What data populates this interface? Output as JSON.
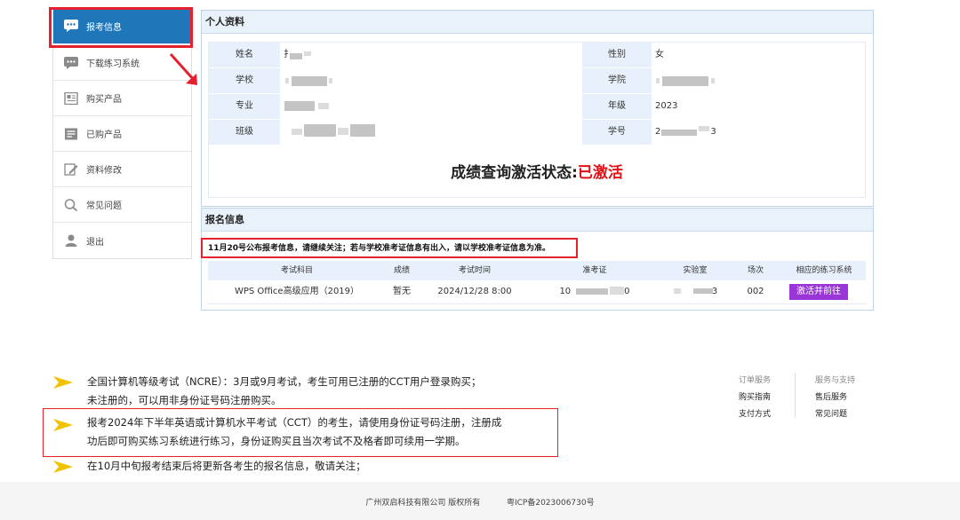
{
  "sidebar": {
    "items": [
      {
        "label": "报考信息",
        "icon": "chat-icon",
        "active": true
      },
      {
        "label": "下载练习系统",
        "icon": "chat-icon"
      },
      {
        "label": "购买产品",
        "icon": "newspaper-icon"
      },
      {
        "label": "已购产品",
        "icon": "list-icon"
      },
      {
        "label": "资料修改",
        "icon": "edit-icon"
      },
      {
        "label": "常见问题",
        "icon": "search-icon"
      },
      {
        "label": "退出",
        "icon": "user-icon"
      }
    ]
  },
  "profile": {
    "title": "个人资料",
    "rows": [
      {
        "l1": "姓名",
        "v1": "",
        "l2": "性别",
        "v2": "女"
      },
      {
        "l1": "学校",
        "v1": "",
        "l2": "学院",
        "v2": ""
      },
      {
        "l1": "专业",
        "v1": "",
        "l2": "年级",
        "v2": "2023"
      },
      {
        "l1": "班级",
        "v1": "",
        "l2": "学号",
        "v2": ""
      }
    ],
    "v1_row1": "扌",
    "v1_row2": "",
    "v1_row3": "",
    "v1_row4": "",
    "v2_row2": "",
    "v2_row4_pre": "2",
    "v2_row4_post": "3",
    "status_label": "成绩查询激活状态:",
    "status_value": "已激活"
  },
  "registration": {
    "title": "报名信息",
    "notice": "11月20号公布报考信息，请继续关注；若与学校准考证信息有出入，请以学校准考证信息为准。",
    "columns": [
      "考试科目",
      "成绩",
      "考试时间",
      "准考证",
      "实验室",
      "场次",
      "相应的练习系统"
    ],
    "rows": [
      {
        "subject": "WPS Office高级应用（2019）",
        "score": "暂无",
        "time": "2024/12/28 8:00",
        "ticket_pre": "10",
        "ticket_post": "0",
        "lab_post": "3",
        "session": "002",
        "action": "激活并前往"
      }
    ]
  },
  "notes": [
    "全国计算机等级考试（NCRE）：3月或9月考试，考生可用已注册的CCT用户登录购买；",
    "未注册的，可以用非身份证号码注册购买。",
    "报考2024年下半年英语或计算机水平考试（CCT）的考生，请使用身份证号码注册，注册成",
    "功后即可购买练习系统进行练习，身份证购买且当次考试不及格者即可续用一学期。",
    "在10月中旬报考结束后将更新各考生的报名信息，敬请关注；"
  ],
  "links": {
    "col1": {
      "header": "订单服务",
      "items": [
        "购买指南",
        "支付方式"
      ]
    },
    "col2": {
      "header": "服务与支持",
      "items": [
        "售后服务",
        "常见问题"
      ]
    }
  },
  "footer": {
    "company": "广州双启科技有限公司 版权所有",
    "icp": "粤ICP备2023006730号"
  },
  "colors": {
    "accent": "#1f77ba",
    "highlight": "#e5212d",
    "button": "#9a35d8",
    "status": "#e30f14"
  }
}
